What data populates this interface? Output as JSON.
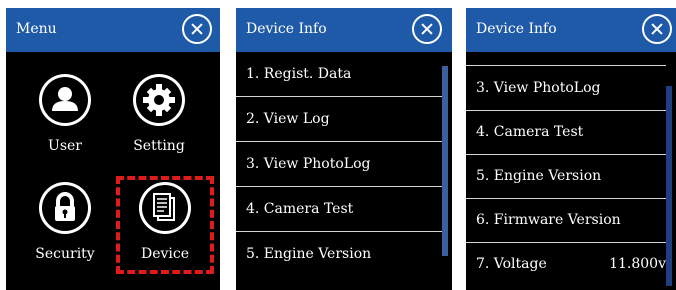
{
  "menu_screen": {
    "title": "Menu",
    "icons": {
      "user": "user-icon",
      "setting": "gear-icon",
      "security": "lock-icon",
      "device": "device-icon"
    },
    "items": [
      {
        "label": "User"
      },
      {
        "label": "Setting"
      },
      {
        "label": "Security"
      },
      {
        "label": "Device"
      }
    ],
    "highlight_color": "#e01b1b"
  },
  "device_info_screen_1": {
    "title": "Device Info",
    "items": [
      {
        "label": "1. Regist. Data"
      },
      {
        "label": "2. View Log"
      },
      {
        "label": "3. View PhotoLog"
      },
      {
        "label": "4. Camera Test"
      },
      {
        "label": "5. Engine Version"
      }
    ]
  },
  "device_info_screen_2": {
    "title": "Device Info",
    "items": [
      {
        "label": "3. View PhotoLog",
        "value": ""
      },
      {
        "label": "4. Camera Test",
        "value": ""
      },
      {
        "label": "5. Engine Version",
        "value": ""
      },
      {
        "label": "6. Firmware Version",
        "value": ""
      },
      {
        "label": "7. Voltage",
        "value": "11.800v"
      }
    ]
  },
  "colors": {
    "titlebar": "#1f5aa8",
    "background": "#000000",
    "text": "#ffffff"
  }
}
